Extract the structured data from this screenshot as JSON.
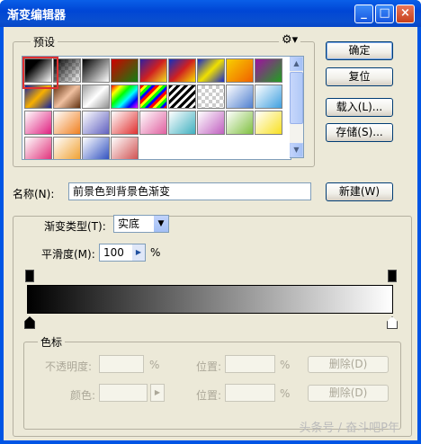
{
  "window": {
    "title": "渐变编辑器",
    "controls": {
      "minimize": "_",
      "maximize": "□",
      "close": "×"
    }
  },
  "presets": {
    "label": "预设",
    "menu_icon": "gear-icon"
  },
  "buttons": {
    "ok": "确定",
    "reset": "复位",
    "load": "载入(L)...",
    "save": "存储(S)...",
    "new": "新建(W)"
  },
  "name": {
    "label": "名称(N):",
    "value": "前景色到背景色渐变"
  },
  "gradient": {
    "type_label": "渐变类型(T):",
    "type_value": "实底",
    "smoothness_label": "平滑度(M):",
    "smoothness_value": "100",
    "smoothness_unit": "%"
  },
  "stops": {
    "label": "色标",
    "opacity_label": "不透明度:",
    "opacity_unit": "%",
    "location_label_1": "位置:",
    "location_unit_1": "%",
    "delete_1": "删除(D)",
    "color_label": "颜色:",
    "location_label_2": "位置:",
    "location_unit_2": "%",
    "delete_2": "删除(D)"
  },
  "watermark": "头条号 / 奋斗吧P年",
  "colors": {
    "highlight": "#e03030",
    "titlebar": "#0a5fe8"
  }
}
